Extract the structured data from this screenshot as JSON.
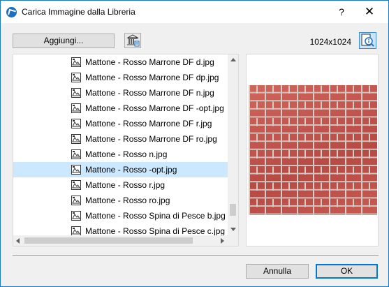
{
  "window": {
    "title": "Carica Immagine dalla Libreria",
    "help_label": "?",
    "close_label": "✕"
  },
  "toolbar": {
    "add_label": "Aggiungi...",
    "resolution": "1024x1024"
  },
  "files": [
    {
      "name": "Mattone - Rosso Marrone DF d.jpg",
      "selected": false
    },
    {
      "name": "Mattone - Rosso Marrone DF dp.jpg",
      "selected": false
    },
    {
      "name": "Mattone - Rosso Marrone DF n.jpg",
      "selected": false
    },
    {
      "name": "Mattone - Rosso Marrone DF -opt.jpg",
      "selected": false
    },
    {
      "name": "Mattone - Rosso Marrone DF r.jpg",
      "selected": false
    },
    {
      "name": "Mattone - Rosso Marrone DF ro.jpg",
      "selected": false
    },
    {
      "name": "Mattone - Rosso n.jpg",
      "selected": false
    },
    {
      "name": "Mattone - Rosso -opt.jpg",
      "selected": true
    },
    {
      "name": "Mattone - Rosso r.jpg",
      "selected": false
    },
    {
      "name": "Mattone - Rosso ro.jpg",
      "selected": false
    },
    {
      "name": "Mattone - Rosso Spina di Pesce b.jpg",
      "selected": false
    },
    {
      "name": "Mattone - Rosso Spina di Pesce c.jpg",
      "selected": false
    }
  ],
  "footer": {
    "cancel_label": "Annulla",
    "ok_label": "OK"
  },
  "icons": {
    "app": "archicad-app-icon",
    "library": "library-building-icon",
    "preview": "magnifier-info-icon",
    "file": "image-file-icon"
  },
  "colors": {
    "selection": "#cce8ff",
    "accent": "#0078d7"
  }
}
